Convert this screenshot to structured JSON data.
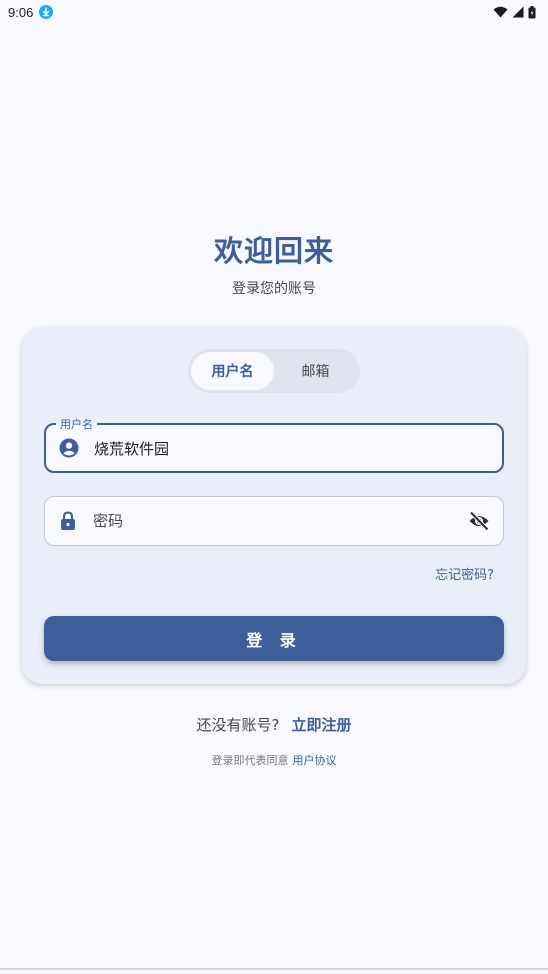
{
  "status_bar": {
    "time": "9:06",
    "icons": [
      "download-icon",
      "wifi-icon",
      "signal-icon",
      "battery-icon"
    ]
  },
  "header": {
    "title": "欢迎回来",
    "subtitle": "登录您的账号"
  },
  "tabs": [
    {
      "label": "用户名",
      "active": true
    },
    {
      "label": "邮箱",
      "active": false
    }
  ],
  "username_field": {
    "label": "用户名",
    "value": "烧荒软件园",
    "icon": "account-circle-icon"
  },
  "password_field": {
    "placeholder": "密码",
    "icon": "lock-icon",
    "toggle_icon": "visibility-off-icon"
  },
  "forgot_password": "忘记密码?",
  "login_button": "登 录",
  "register": {
    "prompt": "还没有账号?",
    "link": "立即注册"
  },
  "agreement": {
    "text": "登录即代表同意",
    "link": "用户协议"
  },
  "colors": {
    "primary": "#3d5e98",
    "background": "#f8f9fe",
    "card": "#eaeef8"
  }
}
